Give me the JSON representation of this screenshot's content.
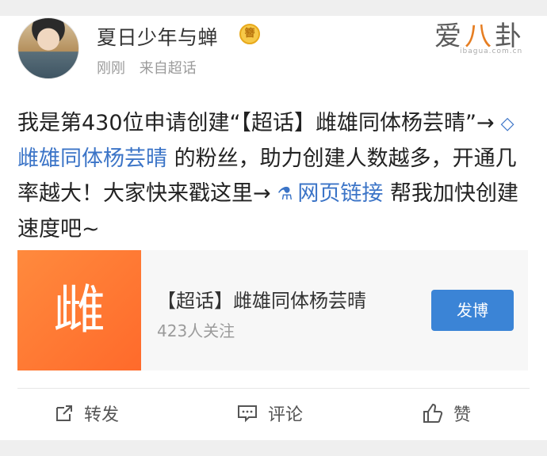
{
  "post": {
    "username": "夏日少年与蝉",
    "badge_icon": "vip-badge-icon",
    "badge_text": "簪",
    "time": "刚刚",
    "source": "来自超话",
    "text_part1": "我是第430位申请创建“【超话】雌雄同体杨芸晴”→",
    "topic_link": "雌雄同体杨芸晴",
    "text_part2": "的粉丝，助力创建人数越多，开通几率越大！大家快来戳这里→",
    "web_link": "网页链接",
    "text_part3": "帮我加快创建速度吧~"
  },
  "topic_card": {
    "thumb_char": "雌",
    "title": "【超话】雌雄同体杨芸晴",
    "followers": "423人关注",
    "post_button": "发博"
  },
  "actions": {
    "repost": "转发",
    "comment": "评论",
    "like": "赞"
  },
  "watermark": {
    "text_left": "爱",
    "text_mid": "八",
    "text_right": "卦",
    "sub": "ibagua.com.cn"
  },
  "colors": {
    "link": "#3b74c7",
    "button": "#3b84d6",
    "thumb": "#ff7a33"
  }
}
